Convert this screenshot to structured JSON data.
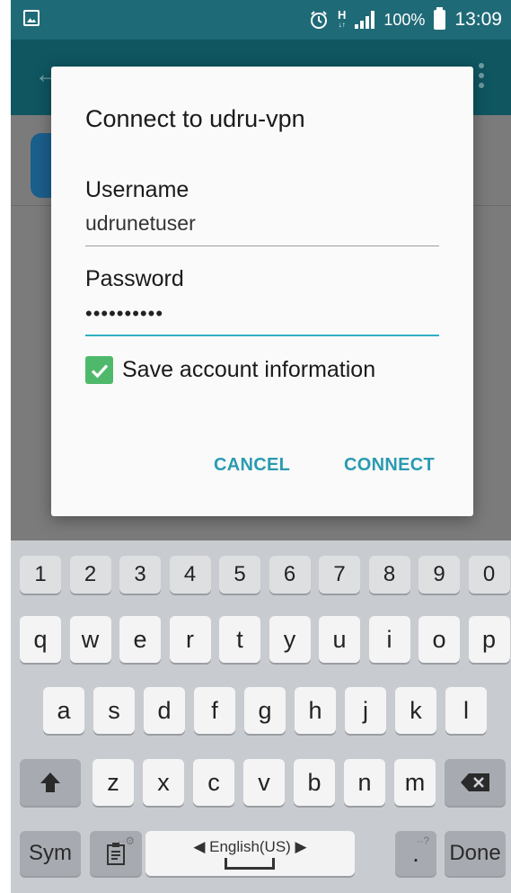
{
  "status_bar": {
    "network": "H",
    "battery": "100%",
    "time": "13:09"
  },
  "dialog": {
    "title": "Connect to udru-vpn",
    "username_label": "Username",
    "username_value": "udrunetuser",
    "password_label": "Password",
    "password_value": "••••••••••",
    "save_label": "Save account information",
    "save_checked": true,
    "cancel_label": "CANCEL",
    "connect_label": "CONNECT"
  },
  "keyboard": {
    "numbers": [
      "1",
      "2",
      "3",
      "4",
      "5",
      "6",
      "7",
      "8",
      "9",
      "0"
    ],
    "row1": [
      "q",
      "w",
      "e",
      "r",
      "t",
      "y",
      "u",
      "i",
      "o",
      "p"
    ],
    "row2": [
      "a",
      "s",
      "d",
      "f",
      "g",
      "h",
      "j",
      "k",
      "l"
    ],
    "row3": [
      "z",
      "x",
      "c",
      "v",
      "b",
      "n",
      "m"
    ],
    "sym_label": "Sym",
    "space_label": "◀ English(US) ▶",
    "period_label": ".",
    "done_label": "Done"
  }
}
